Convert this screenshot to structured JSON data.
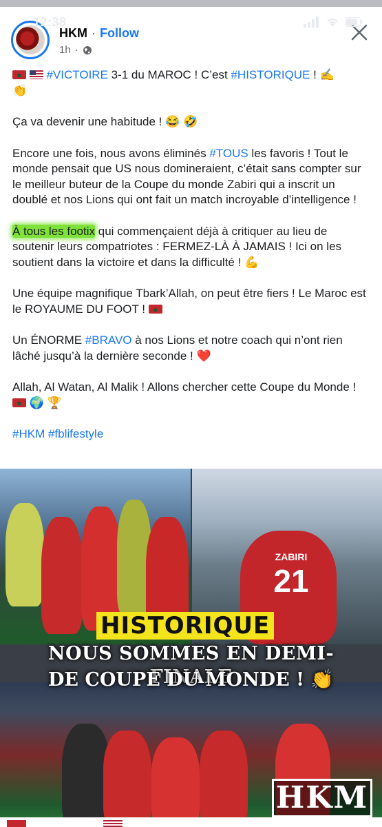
{
  "status_bar": {
    "time": "12:38"
  },
  "header": {
    "author": "HKM",
    "separator": "·",
    "follow_label": "Follow",
    "time_ago": "1h",
    "separator2": "·"
  },
  "post": {
    "p1_tag1": "#VICTOIRE",
    "p1_text1": " 3-1 du MAROC ! C’est ",
    "p1_tag2": "#HISTORIQUE",
    "p1_text2": " ! ✍️",
    "p1_emoji": "👏",
    "p2": "Ça va devenir une habitude ! 😂 🤣",
    "p3_text1": "Encore une fois, nous avons éliminés ",
    "p3_tag": "#TOUS",
    "p3_text2": " les favoris ! Tout le monde pensait que US nous domineraient, c’était sans compter sur le meilleur buteur de la Coupe du monde Zabiri qui a inscrit un doublé et nos Lions qui ont fait un match incroyable d’intelligence !",
    "p4_highlight": "À tous les footix",
    "p4_text": " qui commençaient déjà à critiquer au lieu de soutenir leurs compatriotes : FERMEZ-LÀ À JAMAIS ! Ici on les soutient dans la victoire et dans la difficulté ! 💪",
    "p5_text": "Une équipe magnifique Tbark’Allah, on peut être fiers ! Le Maroc est le ROYAUME DU FOOT ! ",
    "p6_text1": "Un ÉNORME ",
    "p6_tag": "#BRAVO",
    "p6_text2": " à nos Lions et notre coach qui n’ont rien lâché jusqu’à la dernière seconde ! ❤️",
    "p7_text": "Allah, Al Watan, Al Malik ! Allons chercher cette Coupe du Monde ! ",
    "p7_emoji": "🌍 🏆",
    "hashtag1": "#HKM",
    "hashtag2": "#fblifestyle"
  },
  "media": {
    "headline1": "HISTORIQUE",
    "headline2": "NOUS SOMMES EN DEMI-FINALE",
    "headline3": "DE COUPE DU MONDE ! 👏",
    "shirt_name": "ZABIRI",
    "shirt_number": "21",
    "logo": "HKM"
  },
  "colors": {
    "link": "#1877f2",
    "highlight": "#7ee23a",
    "headline_bg": "#f4e41c"
  }
}
